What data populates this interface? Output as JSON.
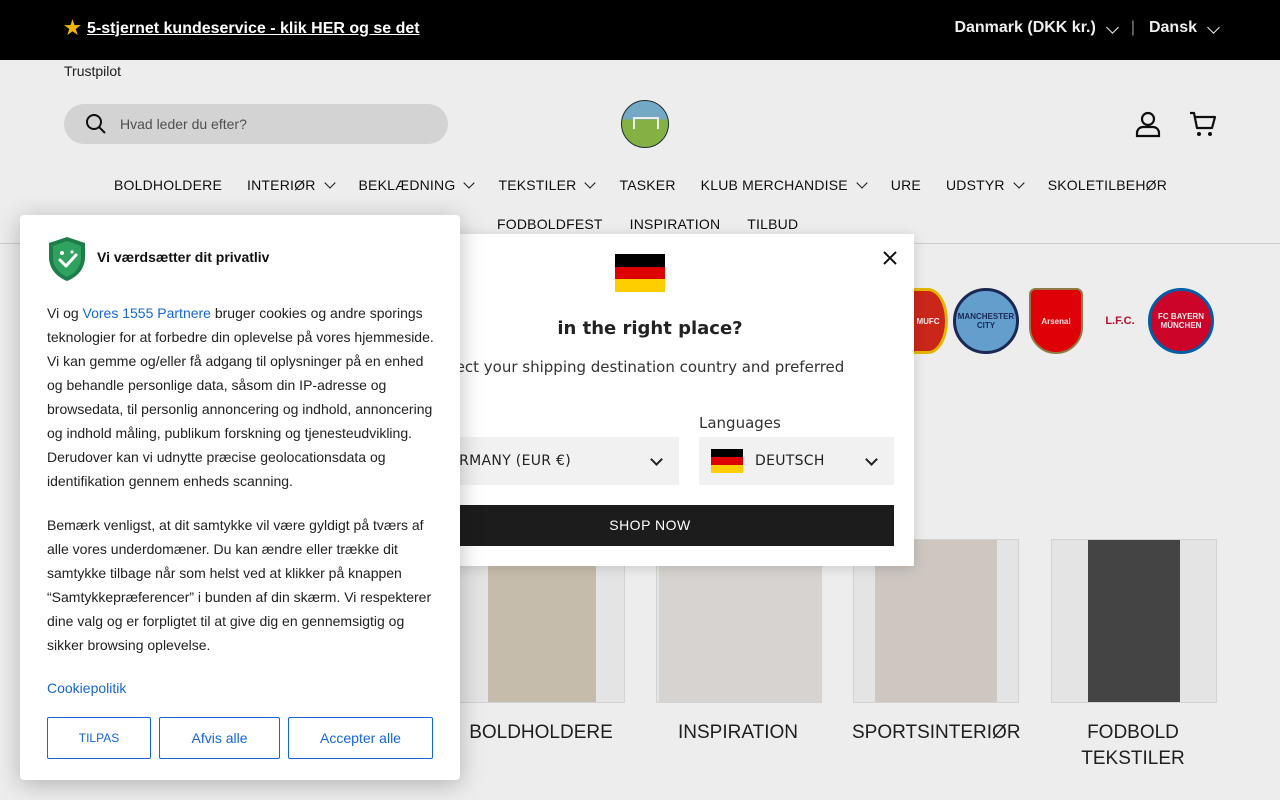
{
  "announcement": {
    "text": "5-stjernet kundeservice - klik HER og se det",
    "trustpilot": "Trustpilot"
  },
  "locale": {
    "country": "Danmark (DKK kr.)",
    "language": "Dansk"
  },
  "search": {
    "placeholder": "Hvad leder du efter?"
  },
  "nav": {
    "row1": [
      "BOLDHOLDERE",
      "INTERIØR",
      "BEKLÆDNING",
      "TEKSTILER",
      "TASKER",
      "KLUB MERCHANDISE",
      "URE",
      "UDSTYR",
      "SKOLETILBEHØR"
    ],
    "row2": [
      "FODBOLDFEST",
      "INSPIRATION",
      "TILBUD"
    ]
  },
  "categories": [
    "BOLDHOLDERE",
    "INSPIRATION",
    "SPORTSINTERIØR",
    "FODBOLD TEKSTILER"
  ],
  "clubs": [
    "manchester-united-crest",
    "manchester-city-crest",
    "arsenal-crest",
    "liverpool-crest",
    "bayern-munchen-crest"
  ],
  "geo_modal": {
    "heading": "in the right place?",
    "description": "ect your shipping destination country and preferred",
    "country_value": "ERMANY (EUR €)",
    "languages_label": "Languages",
    "language_value": "DEUTSCH",
    "shop_button": "SHOP NOW",
    "flag_colors": [
      "#000000",
      "#dd0000",
      "#ffce00"
    ]
  },
  "consent": {
    "title": "Vi værdsætter dit privatliv",
    "p1_pre": "Vi og ",
    "p1_link": "Vores 1555 Partnere",
    "p1_post": " bruger cookies og andre sporings teknologier for at forbedre din oplevelse på vores hjemmeside. Vi kan gemme og/eller få adgang til oplysninger på en enhed og behandle personlige data, såsom din IP-adresse og browsedata, til personlig annoncering og indhold, annoncering og indhold måling, publikum forskning og tjenesteudvikling. Derudover kan vi udnytte præcise geolocationsdata og identifikation gennem enheds scanning.",
    "p2": "Bemærk venligst, at dit samtykke vil være gyldigt på tværs af alle vores underdomæner. Du kan ændre eller trække dit samtykke tilbage når som helst ved at klikker på knappen “Samtykkepræferencer” i bunden af din skærm. Vi respekterer dine valg og er forpligtet til at give dig en gennemsigtig og sikker browsing oplevelse.",
    "policy_link": "Cookiepolitik",
    "btn_customize": "TILPAS",
    "btn_reject": "Afvis alle",
    "btn_accept": "Accepter alle",
    "accent": "#1565d8"
  }
}
